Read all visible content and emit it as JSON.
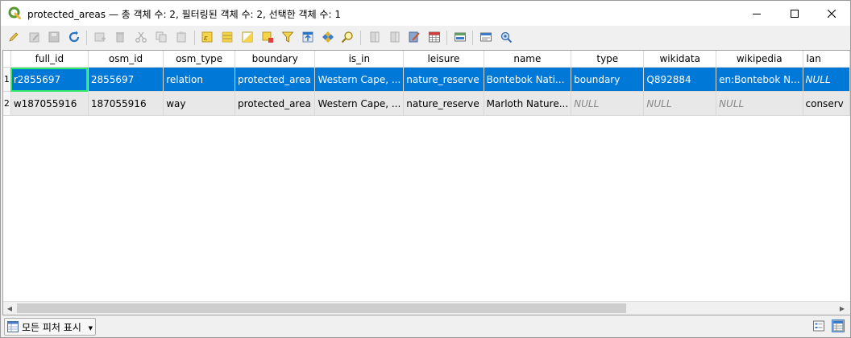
{
  "window": {
    "title": "protected_areas — 총 객체 수: 2, 필터링된 객체 수: 2, 선택한 객체 수: 1"
  },
  "toolbar": {
    "icons": [
      "pencil-icon",
      "multi-edit-icon",
      "save-edits-icon",
      "reload-icon",
      "add-feature-icon",
      "delete-icon",
      "cut-icon",
      "copy-icon",
      "paste-icon",
      "expression-select-icon",
      "select-all-icon",
      "invert-selection-icon",
      "deselect-icon",
      "filter-icon",
      "move-selection-top-icon",
      "pan-to-selection-icon",
      "zoom-to-selection-icon",
      "new-field-icon",
      "delete-field-icon",
      "field-calculator-icon",
      "conditional-formatting-icon",
      "dock-icon",
      "actions-icon"
    ]
  },
  "table": {
    "columns": [
      "full_id",
      "osm_id",
      "osm_type",
      "boundary",
      "is_in",
      "leisure",
      "name",
      "type",
      "wikidata",
      "wikipedia",
      "lan"
    ],
    "rows": [
      {
        "num": "1",
        "cells": [
          "r2855697",
          "2855697",
          "relation",
          "protected_area",
          "Western Cape, ...",
          "nature_reserve",
          "Bontebok Nati...",
          "boundary",
          "Q892884",
          "en:Bontebok N...",
          "NULL"
        ],
        "nulls": [
          false,
          false,
          false,
          false,
          false,
          false,
          false,
          false,
          false,
          false,
          true
        ],
        "selected": true
      },
      {
        "num": "2",
        "cells": [
          "w187055916",
          "187055916",
          "way",
          "protected_area",
          "Western Cape, ...",
          "nature_reserve",
          "Marloth Nature...",
          "NULL",
          "NULL",
          "NULL",
          "conserv"
        ],
        "nulls": [
          false,
          false,
          false,
          false,
          false,
          false,
          false,
          true,
          true,
          true,
          false
        ],
        "selected": false
      }
    ]
  },
  "statusbar": {
    "filter_label": "모든 피처 표시"
  },
  "colors": {
    "selection": "#0078d7",
    "current_cell_outline": "#2ee86a",
    "qgis_green": "#589632"
  }
}
